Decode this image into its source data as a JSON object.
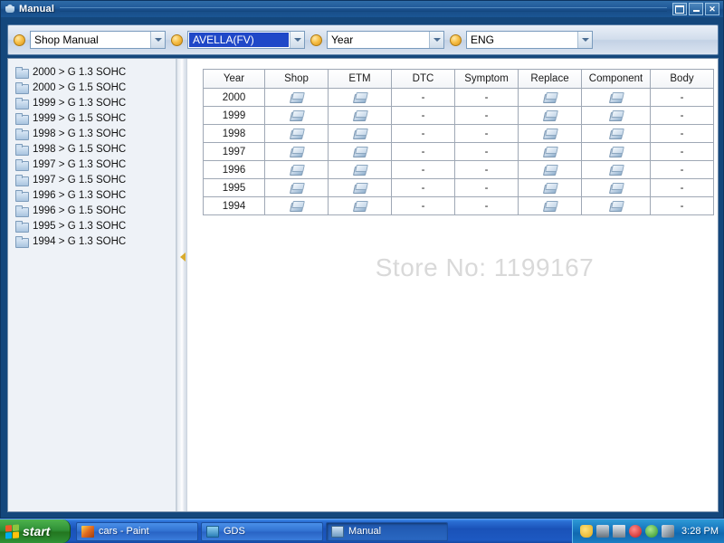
{
  "window": {
    "title": "Manual",
    "icon": "book-icon",
    "controls": {
      "restore_label": "",
      "minimize_label": "",
      "close_label": "✕"
    }
  },
  "toolbar": {
    "combos": [
      {
        "name": "manual-type",
        "value": "Shop Manual",
        "bullet": "bullet-icon",
        "selected": false
      },
      {
        "name": "vehicle-model",
        "value": "AVELLA(FV)",
        "bullet": "bullet-icon",
        "selected": true
      },
      {
        "name": "year",
        "value": "Year",
        "bullet": "bullet-icon",
        "selected": false
      },
      {
        "name": "language",
        "value": "ENG",
        "bullet": "bullet-icon",
        "selected": false
      }
    ]
  },
  "sidebar": {
    "items": [
      {
        "label": "2000 > G 1.3 SOHC",
        "icon": "folder-icon"
      },
      {
        "label": "2000 > G 1.5 SOHC",
        "icon": "folder-icon"
      },
      {
        "label": "1999 > G 1.3 SOHC",
        "icon": "folder-icon"
      },
      {
        "label": "1999 > G 1.5 SOHC",
        "icon": "folder-icon"
      },
      {
        "label": "1998 > G 1.3 SOHC",
        "icon": "folder-icon"
      },
      {
        "label": "1998 > G 1.5 SOHC",
        "icon": "folder-icon"
      },
      {
        "label": "1997 > G 1.3 SOHC",
        "icon": "folder-icon"
      },
      {
        "label": "1997 > G 1.5 SOHC",
        "icon": "folder-icon"
      },
      {
        "label": "1996 > G 1.3 SOHC",
        "icon": "folder-icon"
      },
      {
        "label": "1996 > G 1.5 SOHC",
        "icon": "folder-icon"
      },
      {
        "label": "1995 > G 1.3 SOHC",
        "icon": "folder-icon"
      },
      {
        "label": "1994 > G 1.3 SOHC",
        "icon": "folder-icon"
      }
    ]
  },
  "splitter": {
    "handle_icon": "collapse-left-arrow-icon"
  },
  "table": {
    "columns": [
      "Year",
      "Shop",
      "ETM",
      "DTC",
      "Symptom",
      "Replace",
      "Component",
      "Body"
    ],
    "empty_marker": "-",
    "doc_icon": "book-icon",
    "rows": [
      {
        "year": "2000",
        "shop": "doc",
        "etm": "doc",
        "dtc": "-",
        "symptom": "-",
        "replace": "doc",
        "component": "doc",
        "body": "-"
      },
      {
        "year": "1999",
        "shop": "doc",
        "etm": "doc",
        "dtc": "-",
        "symptom": "-",
        "replace": "doc",
        "component": "doc",
        "body": "-"
      },
      {
        "year": "1998",
        "shop": "doc",
        "etm": "doc",
        "dtc": "-",
        "symptom": "-",
        "replace": "doc",
        "component": "doc",
        "body": "-"
      },
      {
        "year": "1997",
        "shop": "doc",
        "etm": "doc",
        "dtc": "-",
        "symptom": "-",
        "replace": "doc",
        "component": "doc",
        "body": "-"
      },
      {
        "year": "1996",
        "shop": "doc",
        "etm": "doc",
        "dtc": "-",
        "symptom": "-",
        "replace": "doc",
        "component": "doc",
        "body": "-"
      },
      {
        "year": "1995",
        "shop": "doc",
        "etm": "doc",
        "dtc": "-",
        "symptom": "-",
        "replace": "doc",
        "component": "doc",
        "body": "-"
      },
      {
        "year": "1994",
        "shop": "doc",
        "etm": "doc",
        "dtc": "-",
        "symptom": "-",
        "replace": "doc",
        "component": "doc",
        "body": "-"
      }
    ]
  },
  "watermark": {
    "text": "Store No: 1199167"
  },
  "taskbar": {
    "start_label": "start",
    "buttons": [
      {
        "label": "cars - Paint",
        "icon": "paint-icon",
        "icon_class": "paint",
        "active": false
      },
      {
        "label": "GDS",
        "icon": "gds-icon",
        "icon_class": "gds",
        "active": false
      },
      {
        "label": "Manual",
        "icon": "manual-icon",
        "icon_class": "manual",
        "active": true
      }
    ],
    "tray": {
      "icons": [
        "shield-icon",
        "network-icon",
        "printer-icon",
        "antivirus-icon",
        "update-icon",
        "tools-icon"
      ],
      "clock": "3:28 PM"
    }
  },
  "colors": {
    "title_bar": "#1e5898",
    "accent_orange": "#f7c048",
    "selection_blue": "#1f48c8",
    "taskbar_blue": "#1a52b8",
    "start_green": "#2f9137"
  }
}
